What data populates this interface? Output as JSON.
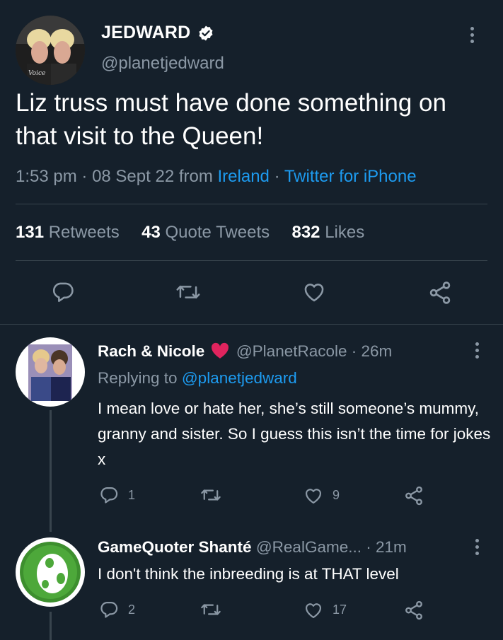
{
  "main_tweet": {
    "display_name": "JEDWARD",
    "handle": "@planetjedward",
    "text": "Liz truss must have done something on that visit to the Queen!",
    "time": "1:53 pm",
    "date": "08 Sept 22",
    "from_label": "from",
    "location": "Ireland",
    "client": "Twitter for iPhone",
    "stats": {
      "retweets_count": "131",
      "retweets_label": "Retweets",
      "quotes_count": "43",
      "quotes_label": "Quote Tweets",
      "likes_count": "832",
      "likes_label": "Likes"
    }
  },
  "replies": [
    {
      "display_name": "Rach & Nicole",
      "handle": "@PlanetRacole",
      "age": "26m",
      "replying_label": "Replying to",
      "replying_to": "@planetjedward",
      "text": "I mean love or hate her, she’s still someone’s mummy, granny and sister. So I guess this isn’t the time for jokes x",
      "reply_count": "1",
      "like_count": "9"
    },
    {
      "display_name": "GameQuoter Shanté",
      "handle": "@RealGame...",
      "age": "21m",
      "text": "I don't think the inbreeding is at THAT level",
      "reply_count": "2",
      "like_count": "17"
    }
  ],
  "icons": [
    "verified-badge-icon",
    "more-icon",
    "reply-icon",
    "retweet-icon",
    "like-icon",
    "share-icon",
    "heart-emoji-icon"
  ],
  "colors": {
    "background": "#15202b",
    "accent": "#1d9bf0",
    "muted": "#8b98a5",
    "divider": "#38444d",
    "heart": "#e0245e"
  }
}
